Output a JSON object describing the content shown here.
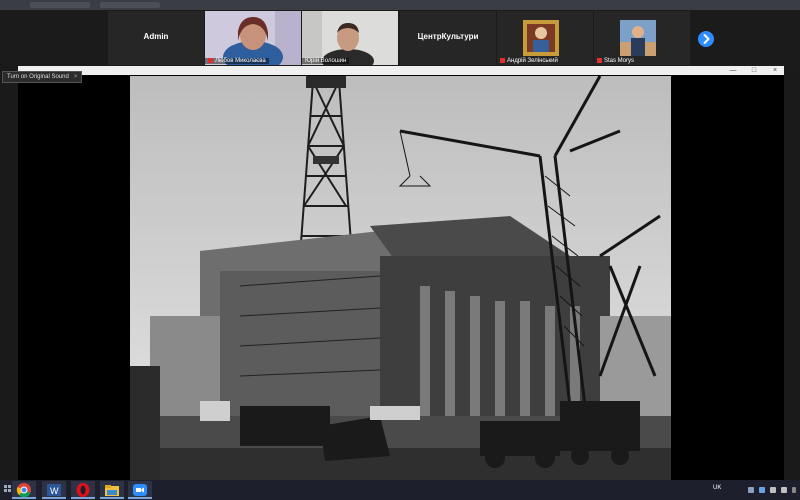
{
  "gallery": {
    "participants": [
      {
        "name": "Admin",
        "type": "name-only"
      },
      {
        "name": "Любов Миколаєва",
        "type": "video",
        "muted": true
      },
      {
        "name": "Юрій Волошин",
        "type": "video",
        "muted": false
      },
      {
        "name": "ЦентрКультури",
        "type": "name-only"
      },
      {
        "name": "Андрій Зелінський",
        "type": "avatar",
        "muted": true
      },
      {
        "name": "Stas Morys",
        "type": "avatar",
        "muted": true
      }
    ],
    "next_icon": "chevron-right-icon"
  },
  "tooltip": {
    "text": "Turn on Original Sound",
    "close": "×"
  },
  "share_window": {
    "minimize": "—",
    "maximize": "□",
    "close": "×"
  },
  "taskbar": {
    "apps": [
      "windows-start-icon",
      "chrome-icon",
      "word-icon",
      "opera-icon",
      "file-explorer-icon",
      "zoom-icon"
    ],
    "language": "UK"
  },
  "colors": {
    "accent": "#2d8cff",
    "mute": "#e03030",
    "taskbar": "#1d1f2c"
  }
}
